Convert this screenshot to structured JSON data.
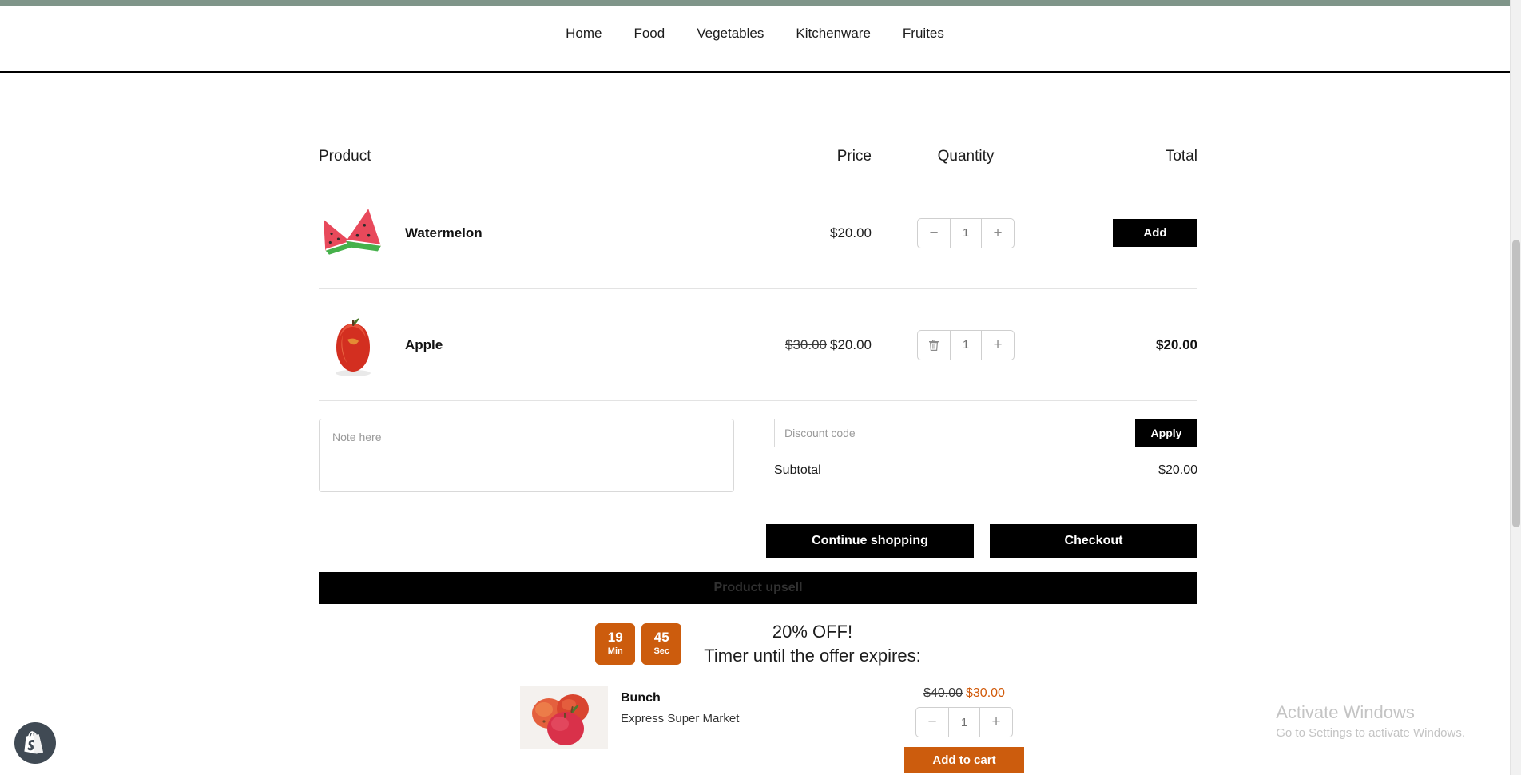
{
  "theme": {
    "accent_bar_color": "#7f9589",
    "button_black": "#000000",
    "orange": "#cc5c0d",
    "shopify_badge_color": "#404a54"
  },
  "header": {
    "nav_items": [
      {
        "label": "Home"
      },
      {
        "label": "Food"
      },
      {
        "label": "Vegetables"
      },
      {
        "label": "Kitchenware"
      },
      {
        "label": "Fruites"
      }
    ]
  },
  "cart": {
    "columns": {
      "product": "Product",
      "price": "Price",
      "quantity": "Quantity",
      "total": "Total"
    },
    "rows": [
      {
        "name": "Watermelon",
        "image": "watermelon-slices-image",
        "price_old": "",
        "price": "$20.00",
        "quantity": "1",
        "remove_icon": "minus-icon",
        "minus_label": "−",
        "plus_label": "+",
        "total": "",
        "action_label": "Add"
      },
      {
        "name": "Apple",
        "image": "red-apple-image",
        "price_old": "$30.00",
        "price": "$20.00",
        "quantity": "1",
        "remove_icon": "trash-icon",
        "minus_label": "",
        "plus_label": "+",
        "total": "$20.00",
        "action_label": ""
      }
    ],
    "note": {
      "placeholder": "Note here",
      "value": ""
    },
    "discount": {
      "placeholder": "Discount code",
      "value": "",
      "apply_label": "Apply"
    },
    "subtotal": {
      "label": "Subtotal",
      "value": "$20.00"
    },
    "continue_shopping_label": "Continue shopping",
    "checkout_label": "Checkout"
  },
  "upsell": {
    "banner_label": "Product upsell",
    "timer": {
      "minutes": "19",
      "minutes_label": "Min",
      "seconds": "45",
      "seconds_label": "Sec"
    },
    "offer_line1": "20% OFF!",
    "offer_line2": "Timer until the offer expires:",
    "product": {
      "image": "apples-bunch-image",
      "title": "Bunch",
      "vendor": "Express Super Market",
      "price_old": "$40.00",
      "price_new": "$30.00",
      "quantity": "1",
      "minus_label": "−",
      "plus_label": "+",
      "add_to_cart_label": "Add to cart"
    }
  },
  "watermark": {
    "title": "Activate Windows",
    "subtitle": "Go to Settings to activate Windows."
  }
}
